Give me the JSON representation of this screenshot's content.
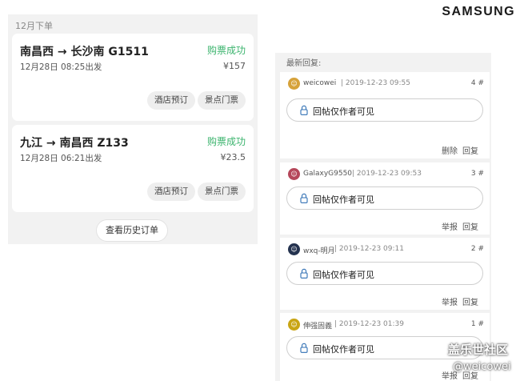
{
  "brand": "SAMSUNG",
  "orders": {
    "month_label": "12月下单",
    "items": [
      {
        "route": "南昌西 → 长沙南 G1511",
        "status": "购票成功",
        "depart": "12月28日 08:25出发",
        "price": "¥157",
        "hotel_label": "酒店预订",
        "scenic_label": "景点门票"
      },
      {
        "route": "九江 → 南昌西 Z133",
        "status": "购票成功",
        "depart": "12月28日 06:21出发",
        "price": "¥23.5",
        "hotel_label": "酒店预订",
        "scenic_label": "景点门票"
      }
    ],
    "history_label": "查看历史订单"
  },
  "replies": {
    "header": "最新回复:",
    "items": [
      {
        "username": "weicowei",
        "time": "| 2019-12-23 09:55",
        "floor": "4 #",
        "content": "回帖仅作者可见",
        "actions": [
          "删除",
          "回复"
        ],
        "avatar_color": "#d6a23a"
      },
      {
        "username": "GalaxyG9550",
        "time": "| 2019-12-23 09:53",
        "floor": "3 #",
        "content": "回帖仅作者可见",
        "actions": [
          "举报",
          "回复"
        ],
        "avatar_color": "#b5475a"
      },
      {
        "username": "wxq-明月",
        "time": "| 2019-12-23 09:11",
        "floor": "2 #",
        "content": "回帖仅作者可见",
        "actions": [
          "举报",
          "回复"
        ],
        "avatar_color": "#24324f"
      },
      {
        "username": "伸强固義",
        "time": "| 2019-12-23 01:39",
        "floor": "1 #",
        "content": "回帖仅作者可见",
        "actions": [
          "举报",
          "回复"
        ],
        "avatar_color": "#c9a514"
      }
    ]
  },
  "watermark": {
    "site": "盖乐世社区",
    "user": "@weicowei"
  },
  "colors": {
    "success": "#3cb46e",
    "panel_bg": "#f2f2f2"
  }
}
